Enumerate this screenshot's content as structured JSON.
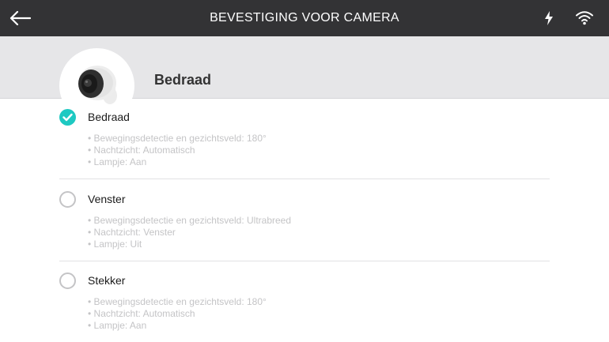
{
  "topbar": {
    "title": "BEVESTIGING VOOR CAMERA",
    "back_icon": "arrow-left-icon",
    "charging_icon": "bolt-icon",
    "network_icon": "wifi-icon"
  },
  "header": {
    "label": "Bedraad",
    "image": "camera-icon"
  },
  "options": [
    {
      "title": "Bedraad",
      "selected": true,
      "details": [
        "• Bewegingsdetectie en gezichtsveld: 180°",
        "• Nachtzicht: Automatisch",
        "• Lampje: Aan"
      ]
    },
    {
      "title": "Venster",
      "selected": false,
      "details": [
        "• Bewegingsdetectie en gezichtsveld: Ultrabreed",
        "• Nachtzicht: Venster",
        "• Lampje: Uit"
      ]
    },
    {
      "title": "Stekker",
      "selected": false,
      "details": [
        "• Bewegingsdetectie en gezichtsveld: 180°",
        "• Nachtzicht: Automatisch",
        "• Lampje: Aan"
      ]
    }
  ],
  "colors": {
    "topbar": "#333335",
    "header_band": "#e6e6e8",
    "accent": "#1ec9c2",
    "detail_text": "#c4c4c6"
  }
}
